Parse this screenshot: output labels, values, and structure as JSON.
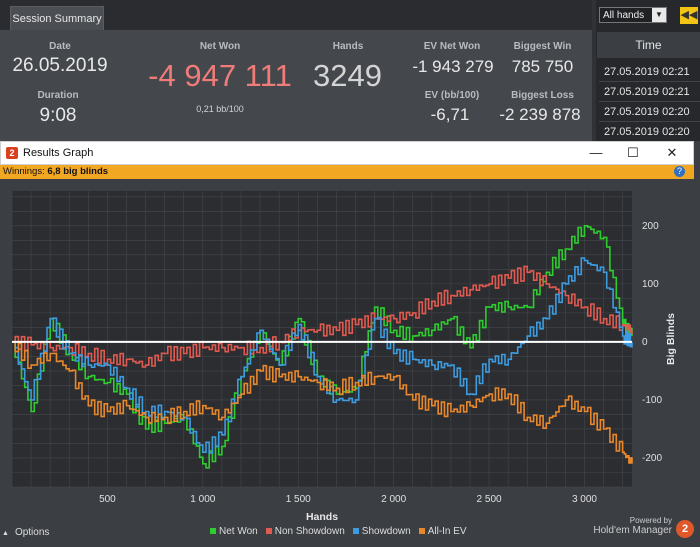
{
  "summary": {
    "tab_label": "Session Summary",
    "date_label": "Date",
    "date_value": "26.05.2019",
    "duration_label": "Duration",
    "duration_value": "9:08",
    "net_won_label": "Net Won",
    "net_won_value": "-4 947 111",
    "net_won_bb": "0,21 bb/100",
    "hands_label": "Hands",
    "hands_value": "3249",
    "ev_net_label": "EV Net Won",
    "ev_net_value": "-1 943 279",
    "ev_bb_label": "EV (bb/100)",
    "ev_bb_value": "-6,71",
    "biggest_win_label": "Biggest Win",
    "biggest_win_value": "785 750",
    "biggest_loss_label": "Biggest Loss",
    "biggest_loss_value": "-2 239 878"
  },
  "filter": {
    "selected": "All hands",
    "arrow": "▼",
    "nav_icon": "◀◀"
  },
  "time_list": {
    "header": "Time",
    "rows": [
      "27.05.2019 02:21",
      "27.05.2019 02:21",
      "27.05.2019 02:20",
      "27.05.2019 02:20"
    ]
  },
  "window": {
    "logo_text": "2",
    "title": "Results Graph",
    "minimize": "—",
    "maximize": "☐",
    "close": "✕",
    "winnings_label": "Winnings:",
    "winnings_value": "6,8 big blinds",
    "help": "?"
  },
  "chart_data": {
    "type": "line",
    "title": "",
    "xlabel": "Hands",
    "ylabel": "Big Blinds",
    "xlim": [
      0,
      3249
    ],
    "ylim": [
      -250,
      260
    ],
    "x_ticks": [
      500,
      1000,
      1500,
      2000,
      2500,
      3000
    ],
    "x_tick_labels": [
      "500",
      "1 000",
      "1 500",
      "2 000",
      "2 500",
      "3 000"
    ],
    "y_ticks": [
      -200,
      -100,
      0,
      100,
      200
    ],
    "y_tick_labels": [
      "-200",
      "-100",
      "0",
      "100",
      "200"
    ],
    "grid": true,
    "x": [
      0,
      100,
      200,
      300,
      400,
      500,
      600,
      700,
      800,
      900,
      1000,
      1100,
      1200,
      1300,
      1400,
      1500,
      1600,
      1700,
      1800,
      1900,
      2000,
      2100,
      2200,
      2300,
      2400,
      2500,
      2600,
      2700,
      2800,
      2900,
      3000,
      3100,
      3200,
      3249
    ],
    "series": [
      {
        "name": "Net Won",
        "color": "#2ecc2e",
        "values": [
          0,
          -120,
          40,
          -20,
          -60,
          -70,
          -90,
          -150,
          -140,
          -130,
          -210,
          -180,
          -60,
          20,
          -40,
          40,
          -60,
          -90,
          -80,
          60,
          20,
          10,
          20,
          40,
          -10,
          60,
          60,
          60,
          120,
          160,
          200,
          180,
          30,
          10
        ]
      },
      {
        "name": "Non Showdown",
        "color": "#e05a4f",
        "values": [
          0,
          -5,
          -10,
          -10,
          -20,
          -30,
          -30,
          -40,
          -20,
          -20,
          -10,
          -10,
          -10,
          -10,
          0,
          20,
          20,
          20,
          30,
          40,
          40,
          50,
          70,
          80,
          90,
          100,
          110,
          120,
          100,
          80,
          60,
          40,
          30,
          20
        ]
      },
      {
        "name": "Showdown",
        "color": "#3d9be0",
        "values": [
          0,
          -100,
          40,
          -20,
          -40,
          -40,
          -80,
          -120,
          -120,
          -130,
          -190,
          -160,
          -60,
          20,
          -40,
          30,
          -60,
          -100,
          -100,
          40,
          -20,
          -30,
          -40,
          -40,
          -90,
          -30,
          -30,
          10,
          40,
          100,
          140,
          120,
          10,
          0
        ]
      },
      {
        "name": "All-In EV",
        "color": "#e8882b",
        "values": [
          0,
          -40,
          -20,
          -50,
          -110,
          -120,
          -110,
          -130,
          -130,
          -120,
          -110,
          -130,
          -90,
          -50,
          -60,
          -60,
          -70,
          -80,
          -70,
          -60,
          -60,
          -100,
          -110,
          -120,
          -110,
          -90,
          -90,
          -130,
          -140,
          -100,
          -120,
          -150,
          -190,
          -210
        ]
      }
    ],
    "legend_placement": "bottom"
  },
  "footer": {
    "options_label": "Options",
    "options_icon": "▲",
    "powered_by": "Powered by",
    "brand": "Hold'em Manager",
    "brand_badge": "2"
  }
}
